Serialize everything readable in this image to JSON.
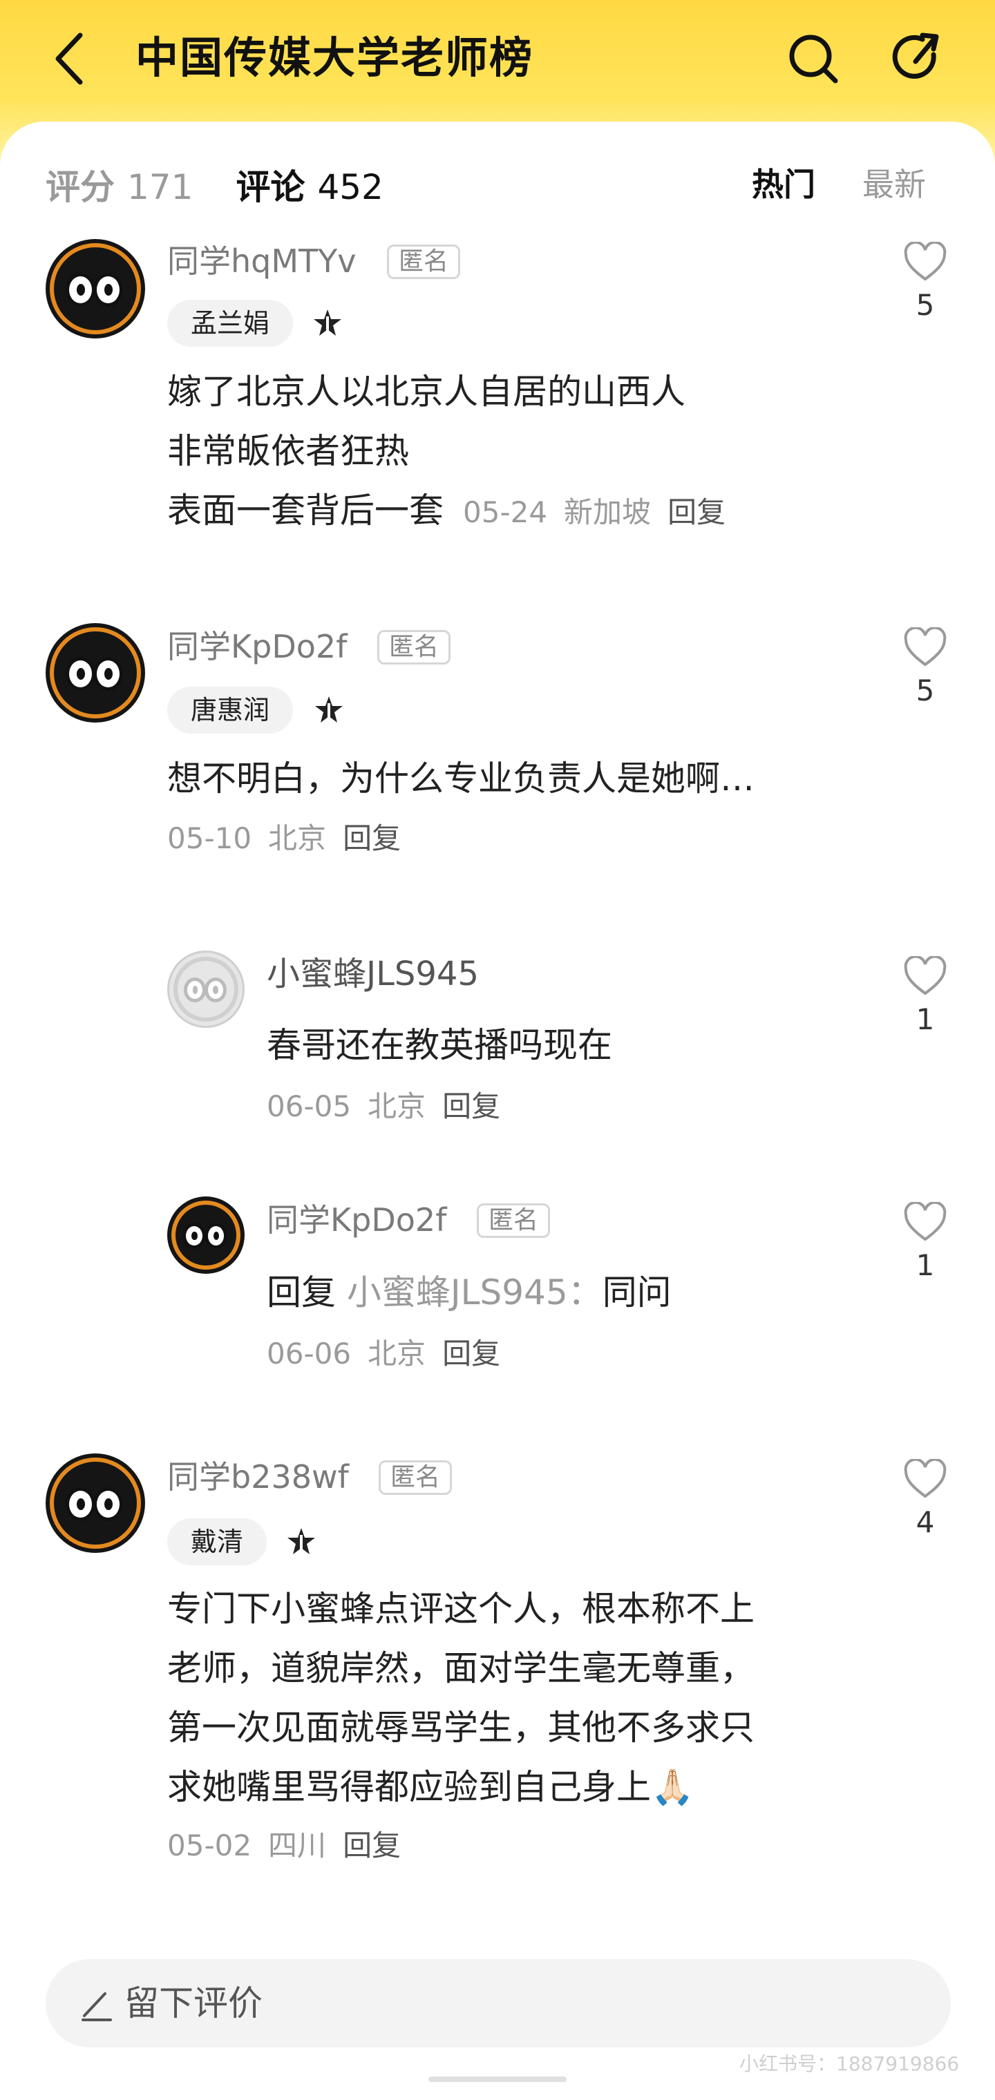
{
  "header": {
    "title": "中国传媒大学老师榜",
    "background_color": "#ffd944"
  },
  "tabs": {
    "score_label": "评分",
    "score_count": "171",
    "comments_label": "评论",
    "comments_count": "452",
    "sort_hot": "热门",
    "sort_new": "最新"
  },
  "comments": [
    {
      "user": "同学hqMTYv",
      "anon": "匿名",
      "teacher": "孟兰娟",
      "lines": [
        "嫁了北京人以北京人自居的山西人",
        "非常皈依者狂热",
        "表面一套背后一套"
      ],
      "date": "05-24",
      "location": "新加坡",
      "reply": "回复",
      "likes": "5"
    },
    {
      "user": "同学KpDo2f",
      "anon": "匿名",
      "teacher": "唐惠润",
      "lines": [
        "想不明白，为什么专业负责人是她啊…"
      ],
      "date": "05-10",
      "location": "北京",
      "reply": "回复",
      "likes": "5"
    },
    {
      "user": "小蜜蜂JLS945",
      "lines": [
        "春哥还在教英播吗现在"
      ],
      "date": "06-05",
      "location": "北京",
      "reply": "回复",
      "likes": "1"
    },
    {
      "user": "同学KpDo2f",
      "anon": "匿名",
      "reply_prefix": "回复",
      "reply_to": "小蜜蜂JLS945",
      "text": "同问",
      "date": "06-06",
      "location": "北京",
      "reply": "回复",
      "likes": "1"
    },
    {
      "user": "同学b238wf",
      "anon": "匿名",
      "teacher": "戴清",
      "lines": [
        "专门下小蜜蜂点评这个人，根本称不上",
        "老师，道貌岸然，面对学生毫无尊重，",
        "第一次见面就辱骂学生，其他不多求只",
        "求她嘴里骂得都应验到自己身上🙏🏻"
      ],
      "date": "05-02",
      "location": "四川",
      "reply": "回复",
      "likes": "4"
    }
  ],
  "input": {
    "placeholder": "留下评价"
  },
  "watermark": "小红书号：1887919866"
}
